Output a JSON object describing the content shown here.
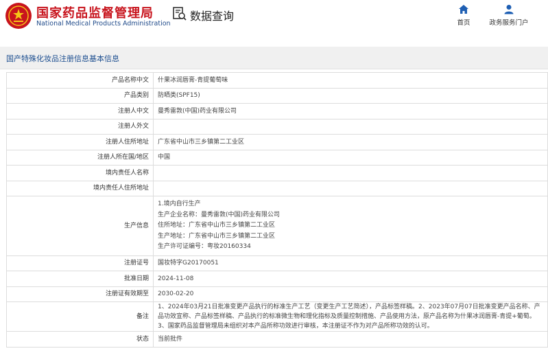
{
  "header": {
    "agency_name_zh": "国家药品监督管理局",
    "agency_name_en": "National Medical Products Administration",
    "page_title": "数据查询",
    "brand_color": "#c8141d",
    "nav": [
      {
        "label": "首页",
        "icon": "home-icon"
      },
      {
        "label": "政务服务门户",
        "icon": "user-icon"
      }
    ]
  },
  "section": {
    "title": "国产特殊化妆品注册信息基本信息",
    "title_color": "#1b4d8f"
  },
  "record": {
    "product_name": {
      "label": "产品名称中文",
      "value": "什果冰润唇膏-青提葡萄味"
    },
    "category": {
      "label": "产品类别",
      "value": "防晒类(SPF15)"
    },
    "registrant_cn": {
      "label": "注册人中文",
      "value": "曼秀雷敦(中国)药业有限公司"
    },
    "registrant_en": {
      "label": "注册人外文",
      "value": ""
    },
    "registrant_address": {
      "label": "注册人住所地址",
      "value": "广东省中山市三乡镇第二工业区"
    },
    "registrant_country": {
      "label": "注册人所在国/地区",
      "value": "中国"
    },
    "domestic_rep_name": {
      "label": "境内责任人名称",
      "value": ""
    },
    "domestic_rep_address": {
      "label": "境内责任人住所地址",
      "value": ""
    },
    "production": {
      "label": "生产信息",
      "lines": [
        "1.境内自行生产",
        "生产企业名称：曼秀雷敦(中国)药业有限公司",
        "住所地址：广东省中山市三乡镇第二工业区",
        "生产地址：广东省中山市三乡镇第二工业区",
        "生产许可证编号：粤妆20160334"
      ]
    },
    "registration_no": {
      "label": "注册证号",
      "value": "国妆特字G20170051"
    },
    "approval_date": {
      "label": "批准日期",
      "value": "2024-11-08"
    },
    "valid_until": {
      "label": "注册证有效期至",
      "value": "2030-02-20"
    },
    "remarks": {
      "label": "备注",
      "value": "1、2024年03月21日批准变更产品执行的标准生产工艺（变更生产工艺简述），产品标签样稿。2、2023年07月07日批准变更产品名称、产品功效宣称、产品标签样稿、产品执行的标准微生物和理化指标及质量控制措施、产品使用方法，原产品名称为什果冰润唇膏-青提+葡萄。3、国家药品监督管理局未组织对本产品所称功效进行审核，本注册证不作为对产品所称功效的认可。"
    },
    "status": {
      "label": "状态",
      "value": "当前批件"
    }
  }
}
